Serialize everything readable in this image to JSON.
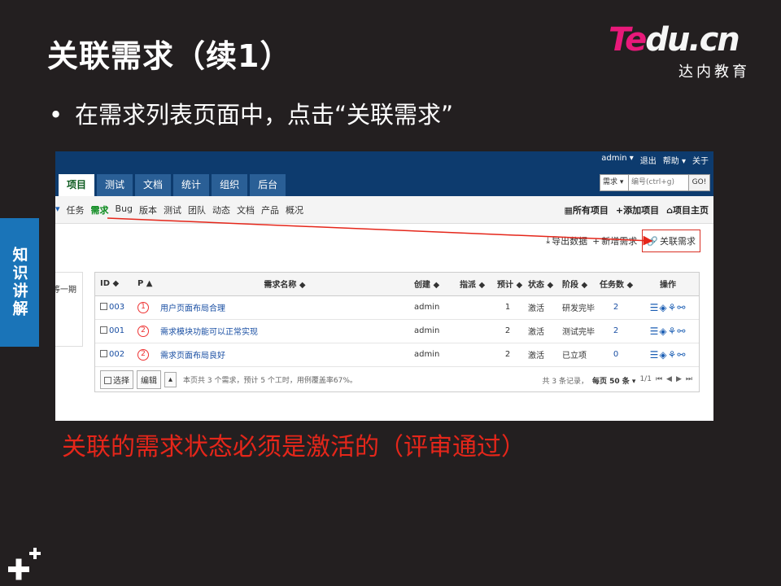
{
  "slide": {
    "title": "关联需求（续1）",
    "bullet": "在需求列表页面中，点击“关联需求”",
    "side_tab": "知识讲解",
    "note": "关联的需求状态必须是激活的（评审通过）",
    "logo_main_left": "Te",
    "logo_main_right": "du.cn",
    "logo_sub": "达内教育",
    "colors": {
      "background": "#231f20",
      "side_tab": "#1a74b8",
      "note": "#e5261a",
      "logo_pink": "#e8197a"
    }
  },
  "app": {
    "userbar": {
      "user": "admin ▾",
      "logout": "退出",
      "help": "帮助 ▾",
      "about": "关于"
    },
    "tabs": [
      "项目",
      "测试",
      "文档",
      "统计",
      "组织",
      "后台"
    ],
    "search": {
      "select": "需求 ▾",
      "placeholder": "编号(ctrl+g)",
      "go": "GO!"
    },
    "subnav": [
      "任务",
      "需求",
      "Bug",
      "版本",
      "测试",
      "团队",
      "动态",
      "文档",
      "产品",
      "概况"
    ],
    "subnav_right": [
      "所有项目",
      "添加项目",
      "项目主页"
    ],
    "actions": {
      "export": "导出数据",
      "add": "新增需求",
      "link": "关联需求"
    },
    "left_panel_text": "等一期",
    "table": {
      "headers": [
        "ID ◆",
        "P ▲",
        "需求名称 ◆",
        "创建 ◆",
        "指派 ◆",
        "预计 ◆",
        "状态 ◆",
        "阶段 ◆",
        "任务数 ◆",
        "操作"
      ],
      "rows": [
        {
          "id": "003",
          "pri": "1",
          "name": "用户页面布局合理",
          "creator": "admin",
          "estimate": "1",
          "status": "激活",
          "stage": "研发完毕",
          "tasks": "2"
        },
        {
          "id": "001",
          "pri": "2",
          "name": "需求模块功能可以正常实现",
          "creator": "admin",
          "estimate": "2",
          "status": "激活",
          "stage": "测试完毕",
          "tasks": "2"
        },
        {
          "id": "002",
          "pri": "2",
          "name": "需求页面布局良好",
          "creator": "admin",
          "estimate": "2",
          "status": "激活",
          "stage": "已立项",
          "tasks": "0"
        }
      ],
      "ops_icons": [
        "list-icon",
        "layers-icon",
        "tree-icon",
        "unlink-icon"
      ],
      "footer": {
        "select_btn": "选择",
        "edit_btn": "编辑",
        "summary": "本页共 3 个需求，预计 5 个工时，用例覆盖率67%。",
        "records": "共 3 条记录，",
        "per_page": "每页 50 条 ▾",
        "page": "1/1"
      }
    }
  }
}
